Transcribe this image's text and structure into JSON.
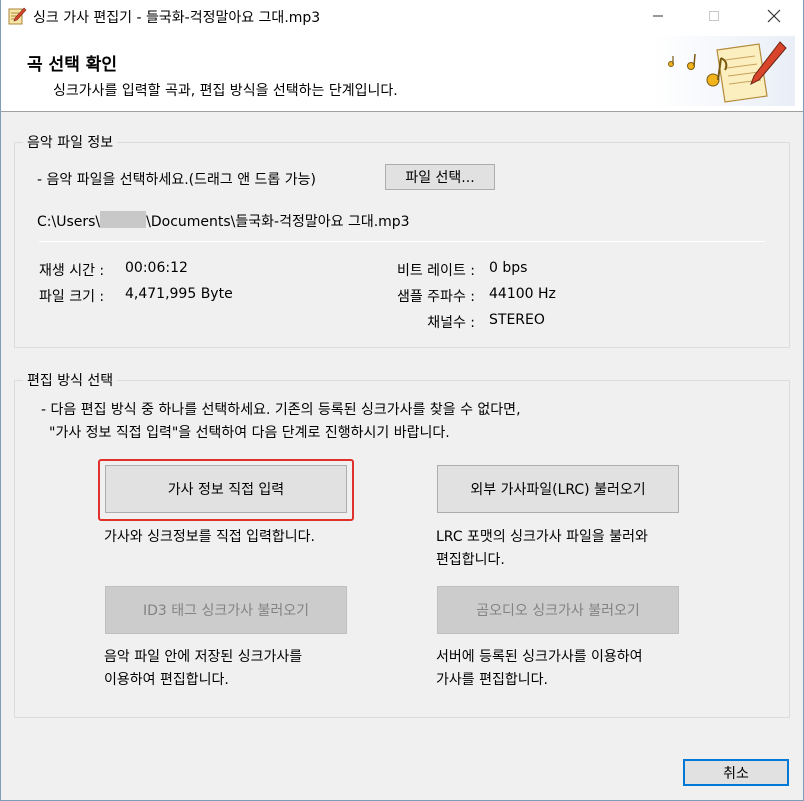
{
  "window": {
    "title": "싱크 가사 편집기 - 들국화-걱정말아요 그대.mp3"
  },
  "header": {
    "title": "곡 선택 확인",
    "subtitle": "싱크가사를 입력할 곡과, 편집 방식을 선택하는 단계입니다."
  },
  "file_info": {
    "group_label": "음악 파일 정보",
    "instruction": "- 음악 파일을 선택하세요.(드래그 앤 드롭 가능)",
    "select_button": "파일 선택...",
    "path_prefix": "C:\\Users\\",
    "path_suffix": "\\Documents\\들국화-걱정말아요 그대.mp3",
    "play_time_label": "재생 시간 :",
    "play_time_value": "00:06:12",
    "file_size_label": "파일 크기 :",
    "file_size_value": "4,471,995 Byte",
    "bitrate_label": "비트 레이트 :",
    "bitrate_value": "0 bps",
    "sample_rate_label": "샘플 주파수 :",
    "sample_rate_value": "44100 Hz",
    "channels_label": "채널수 :",
    "channels_value": "STEREO"
  },
  "edit_mode": {
    "group_label": "편집 방식 선택",
    "instruction_1": "- 다음 편집 방식 중 하나를 선택하세요. 기존의 등록된 싱크가사를 찾을 수 없다면,",
    "instruction_2": "\"가사 정보 직접 입력\"을 선택하여 다음 단계로 진행하시기 바랍니다.",
    "direct_button": "가사 정보 직접 입력",
    "direct_desc": "가사와 싱크정보를 직접 입력합니다.",
    "lrc_button": "외부 가사파일(LRC) 불러오기",
    "lrc_desc_1": "LRC 포맷의 싱크가사 파일을 불러와",
    "lrc_desc_2": "편집합니다.",
    "id3_button": "ID3 태그 싱크가사 불러오기",
    "id3_desc_1": "음악 파일 안에 저장된 싱크가사를",
    "id3_desc_2": "이용하여 편집합니다.",
    "gom_button": "곰오디오 싱크가사 불러오기",
    "gom_desc_1": "서버에 등록된 싱크가사를 이용하여",
    "gom_desc_2": "가사를 편집합니다."
  },
  "footer": {
    "cancel_button": "취소"
  },
  "icons": {
    "app": "notepad-pen-icon",
    "header_art": "music-notes-notepad-icon"
  },
  "colors": {
    "highlight": "#e0312d",
    "default_button_border": "#0078d7"
  }
}
